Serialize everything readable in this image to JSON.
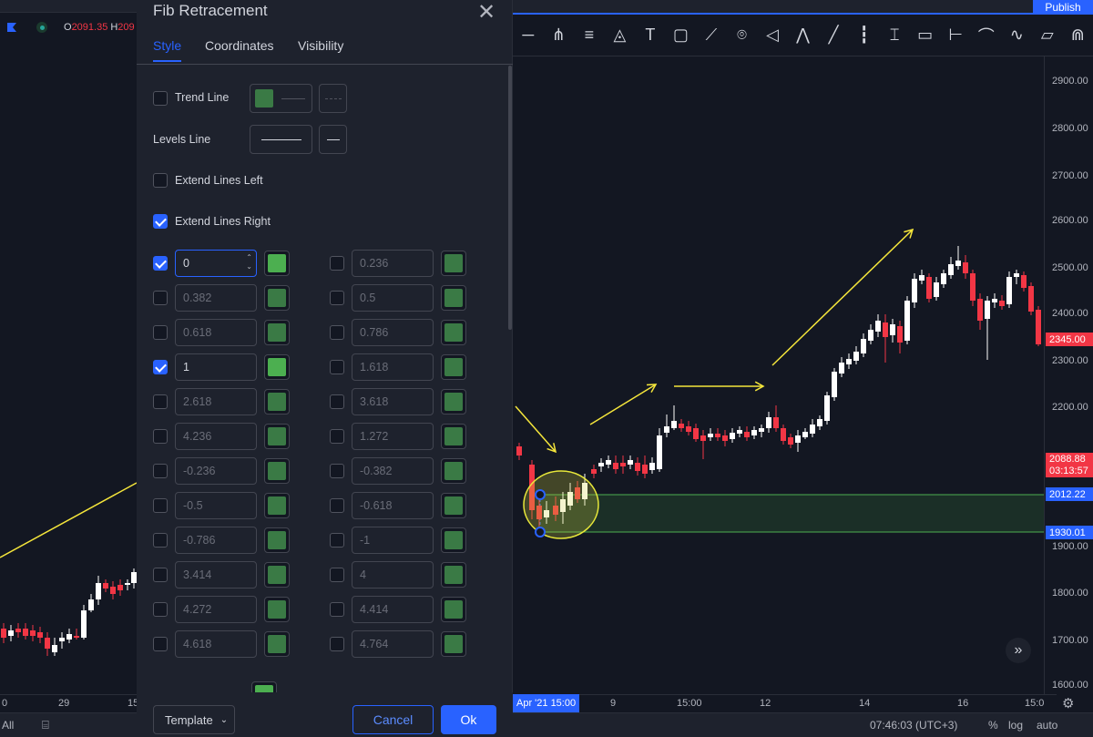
{
  "ohlc": {
    "o_label": "O",
    "o_value": "2091.35",
    "h_label": "H",
    "h_value": "209"
  },
  "toolbar": {
    "publish_label": "Publish",
    "icons": [
      "horizontal-line-icon",
      "pitchfork-icon",
      "channel-icon",
      "triangle-pattern-icon",
      "text-icon",
      "rectangle-icon",
      "brush-icon",
      "pin-icon",
      "gann-fan-icon",
      "elliott-wave-icon",
      "ray-icon",
      "candles-icon",
      "fib-retracement-icon",
      "comment-icon",
      "date-range-icon",
      "path-icon",
      "polyline-icon",
      "shapes-icon",
      "magnet-icon"
    ]
  },
  "price_axis": {
    "labels": [
      "2900.00",
      "2800.00",
      "2700.00",
      "2600.00",
      "2500.00",
      "2400.00",
      "2300.00",
      "2200.00",
      "2000.00",
      "1900.00",
      "1800.00",
      "1700.00",
      "1600.00"
    ],
    "current_price": "2345.00",
    "last_price": "2088.88",
    "countdown": "03:13:57",
    "zone_top": "2012.22",
    "zone_bottom": "1930.01",
    "colors": {
      "up": "#ffffff",
      "down": "#f23645",
      "accent": "#2962ff"
    }
  },
  "time_axis": {
    "labels_left": [
      "0",
      "29",
      "15"
    ],
    "date_tag": "Apr '21  15:00",
    "labels": [
      "9",
      "15:00",
      "12",
      "14",
      "16",
      "15:0"
    ]
  },
  "statusbar": {
    "range": "All",
    "time": "07:46:03 (UTC+3)",
    "pct": "%",
    "log": "log",
    "auto": "auto"
  },
  "dialog": {
    "title": "Fib Retracement",
    "tabs": [
      "Style",
      "Coordinates",
      "Visibility"
    ],
    "trend_line_label": "Trend Line",
    "levels_line_label": "Levels Line",
    "extend_left_label": "Extend Lines Left",
    "extend_right_label": "Extend Lines Right",
    "levels_left": [
      {
        "value": "0",
        "checked": true
      },
      {
        "value": "0.382",
        "checked": false
      },
      {
        "value": "0.618",
        "checked": false
      },
      {
        "value": "1",
        "checked": true
      },
      {
        "value": "2.618",
        "checked": false
      },
      {
        "value": "4.236",
        "checked": false
      },
      {
        "value": "-0.236",
        "checked": false
      },
      {
        "value": "-0.5",
        "checked": false
      },
      {
        "value": "-0.786",
        "checked": false
      },
      {
        "value": "3.414",
        "checked": false
      },
      {
        "value": "4.272",
        "checked": false
      },
      {
        "value": "4.618",
        "checked": false
      }
    ],
    "levels_right": [
      {
        "value": "0.236",
        "checked": false
      },
      {
        "value": "0.5",
        "checked": false
      },
      {
        "value": "0.786",
        "checked": false
      },
      {
        "value": "1.618",
        "checked": false
      },
      {
        "value": "3.618",
        "checked": false
      },
      {
        "value": "1.272",
        "checked": false
      },
      {
        "value": "-0.382",
        "checked": false
      },
      {
        "value": "-0.618",
        "checked": false
      },
      {
        "value": "-1",
        "checked": false
      },
      {
        "value": "4",
        "checked": false
      },
      {
        "value": "4.414",
        "checked": false
      },
      {
        "value": "4.764",
        "checked": false
      }
    ],
    "template_label": "Template",
    "cancel_label": "Cancel",
    "ok_label": "Ok"
  }
}
